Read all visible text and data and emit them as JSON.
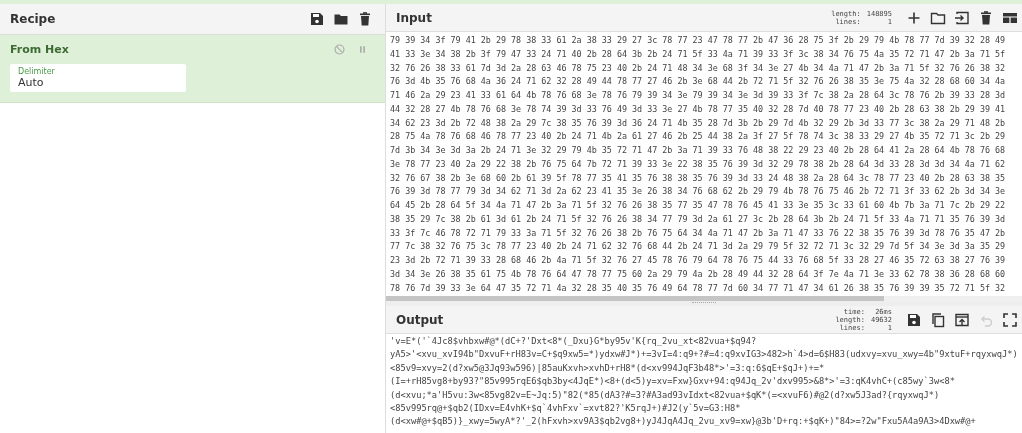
{
  "recipe": {
    "title": "Recipe",
    "buttons": [
      {
        "kind": "save"
      },
      {
        "kind": "folder"
      },
      {
        "kind": "trash"
      }
    ],
    "operations": [
      {
        "name": "From Hex",
        "buttons": [
          {
            "kind": "disable"
          },
          {
            "kind": "pause"
          }
        ],
        "args": [
          {
            "label": "Delimiter",
            "value": "Auto"
          }
        ]
      }
    ]
  },
  "input": {
    "title": "Input",
    "stats": [
      {
        "label": "length:",
        "value": "148895"
      },
      {
        "label": "lines:",
        "value": "1"
      }
    ],
    "buttons": [
      {
        "kind": "plus",
        "disabled": false
      },
      {
        "kind": "folder",
        "disabled": false
      },
      {
        "kind": "import",
        "disabled": false
      },
      {
        "kind": "trash",
        "disabled": false
      },
      {
        "kind": "layout",
        "disabled": false
      }
    ],
    "rows": [
      "79 39 34 3f 79 41 2b 29 78 38 33 61 2a 38 33 29 27 3c 78 77 23 47 78 77 2b 47 36 28 75 3f 2b 29 79 4b 78 77 7d 39 32 28 49",
      "41 33 3e 34 38 2b 3f 79 47 33 24 71 40 2b 28 64 3b 2b 24 71 5f 33 4a 71 39 33 3f 3c 38 34 76 75 4a 35 72 71 47 2b 3a 71 5f",
      "32 76 26 38 33 61 7d 3d 2a 28 63 46 78 75 23 40 2b 24 71 48 34 3e 68 3f 34 3e 27 4b 34 4a 71 47 2b 3a 71 5f 32 76 26 38 32",
      "76 3d 4b 35 76 68 4a 36 24 71 62 32 28 49 44 78 77 27 46 2b 3e 68 44 2b 72 71 5f 32 76 26 38 35 3e 75 4a 32 28 68 60 34 4a",
      "71 46 2a 29 23 41 33 61 64 4b 78 76 68 3e 78 76 79 39 34 3e 79 39 34 3e 3d 39 33 3f 7c 38 2a 28 64 3c 78 76 2b 39 33 28 3d",
      "44 32 28 27 4b 78 76 68 3e 78 74 39 3d 33 76 49 3d 33 3e 27 4b 78 77 35 40 32 28 7d 40 78 77 23 40 2b 28 63 38 2b 29 39 41",
      "34 62 23 3d 2b 72 48 38 2a 29 7c 38 35 76 39 3d 36 24 71 4b 35 28 7d 3b 2b 29 7d 4b 32 29 2b 3d 33 77 3c 38 2a 29 71 48 2b",
      "28 75 4a 78 76 68 46 78 77 23 40 2b 24 71 4b 2a 61 27 46 2b 25 44 38 2a 3f 27 5f 78 74 3c 38 33 29 27 4b 35 72 71 3c 2b 29",
      "7d 3b 34 3e 3d 3a 2b 24 71 3e 32 29 79 4b 35 72 71 47 2b 3a 71 39 33 76 48 38 22 29 23 40 2b 28 64 41 2a 28 64 4b 78 76 68",
      "3e 78 77 23 40 2a 29 22 38 2b 76 75 64 7b 72 71 39 33 3e 22 38 35 76 39 3d 32 29 78 38 2b 28 64 3d 33 28 3d 3d 34 4a 71 62",
      "32 76 67 38 2b 3e 68 60 2b 61 39 5f 78 77 35 41 35 76 38 38 35 76 39 3d 33 24 48 38 2a 28 64 3c 78 77 23 40 2b 28 63 38 35",
      "76 39 3d 78 77 79 3d 34 62 71 3d 2a 62 23 41 35 3e 26 38 34 76 68 62 2b 29 79 4b 78 76 75 46 2b 72 71 3f 33 62 2b 3d 34 3e",
      "64 45 2b 28 64 5f 34 4a 71 47 2b 3a 71 5f 32 76 26 38 35 77 35 47 78 76 45 41 33 3e 35 3c 33 61 60 4b 7b 3a 71 7c 2b 29 22",
      "38 35 29 7c 38 2b 61 3d 61 2b 24 71 5f 32 76 26 38 34 77 79 3d 2a 61 27 3c 2b 28 64 3b 2b 24 71 5f 33 4a 71 71 35 76 39 3d",
      "33 3f 7c 46 78 72 71 79 33 3a 71 5f 32 76 26 38 2b 76 75 64 34 4a 71 47 2b 3a 71 47 33 76 22 38 35 76 39 3d 78 76 35 47 2b",
      "77 7c 38 32 76 75 3c 78 77 23 40 2b 24 71 62 32 76 68 44 2b 24 71 3d 2a 29 79 5f 32 72 71 3c 32 29 7d 5f 34 3e 3d 3a 35 29",
      "23 3d 2b 72 71 39 33 28 68 46 2b 4a 71 5f 32 76 27 45 78 76 79 64 78 76 75 44 33 76 68 5f 33 28 27 46 35 72 63 38 27 76 39",
      "3d 34 3e 26 38 35 61 75 4b 78 76 64 47 78 77 75 60 2a 29 79 4a 2b 28 49 44 32 28 64 3f 7e 4a 71 3e 33 62 78 38 36 28 68 60",
      "78 76 7d 39 33 3e 64 47 35 72 71 4a 32 28 35 40 35 76 49 64 78 77 7d 60 34 77 71 47 34 61 26 38 35 76 39 39 35 72 71 5f 32"
    ]
  },
  "output": {
    "title": "Output",
    "stats": [
      {
        "label": "time:",
        "value": "26ms"
      },
      {
        "label": "length:",
        "value": "49632"
      },
      {
        "label": "lines:",
        "value": "1"
      }
    ],
    "buttons": [
      {
        "kind": "save",
        "disabled": false
      },
      {
        "kind": "copy",
        "disabled": false
      },
      {
        "kind": "open",
        "disabled": false
      },
      {
        "kind": "undo",
        "disabled": true
      },
      {
        "kind": "fullscreen",
        "disabled": false
      }
    ],
    "rows": [
      "'v=E*('`4Jc8$vhbxw#@*(dC+?'Dxt<8*(_Dxu}G*by95v'K{rq_2vu_xt<82vua+$q94?",
      "yA5>'<xvu_xvI94b\"DxvuF+rH83v=C+$q9xw5=*)ydxw#J*)+=3vI=4:q9+?#=4:q9xvIG3>482>h`4>d=6$H83(udxvy=xvu_xwy=4b\"9xtuF+rqyxwqJ*)",
      "<85v9=xvy=2(d?xw5@3Jq93w596)|85auKxvh>xvhD+rH8*(d<xv994JqF3b48*>'=3:q:6$qE+$qJ+)+=*",
      "(I=+rH85vg8+by93?\"85v995rqE6$qb3by<4JqE*)<8+(d<5)y=xv=Fxw}Gxv+94:q94Jq_2v'dxv995>&8*>'=3:qK4vhC+(c85wy`3w<8*",
      "(d<xvu;*a'H5vu:3w<85vg82v=E~Jq:5)\"82(*85(dA3?#=3?#A3ad93vIdxt<82vua+$qK*(=<xvuF6)#@2(d?xw5J3ad?{rqyxwqJ*)",
      "<85v995rq@+$qb2(IDxv=E4vhK+$q`4vhFxv`=xvt82?'K5rqJ+)#J2(y`5v=G3:H8*",
      "(d<xw#@+$qB5)}_xwy=5wyA*?'_2(hFxvh>xv9A3$qb2vg8+)yJ4JqA4Jq_2vu_xv9=xw}@3b'D+rq:+$qK+)\"84>=?2w\"Fxu5A4a9A3>4Dxw#@+"
    ]
  }
}
